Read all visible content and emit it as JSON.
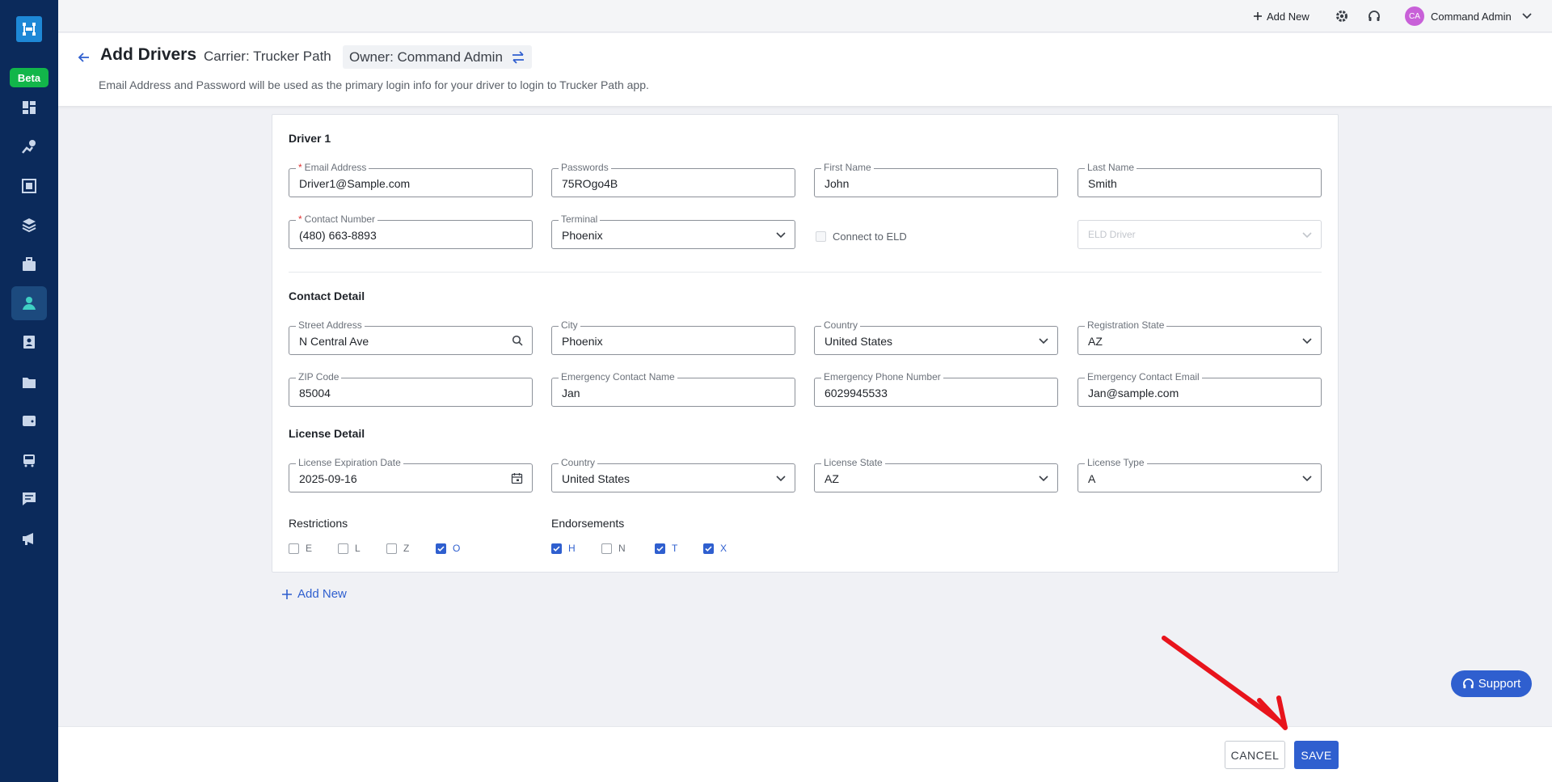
{
  "sidebar": {
    "beta_label": "Beta",
    "items": [
      {
        "icon": "dashboard-icon"
      },
      {
        "icon": "route-pin-icon"
      },
      {
        "icon": "dispatch-board-icon"
      },
      {
        "icon": "layers-icon"
      },
      {
        "icon": "briefcase-icon"
      },
      {
        "icon": "drivers-icon",
        "active": true
      },
      {
        "icon": "contact-card-icon"
      },
      {
        "icon": "folder-icon"
      },
      {
        "icon": "wallet-icon"
      },
      {
        "icon": "truck-icon"
      },
      {
        "icon": "message-icon"
      },
      {
        "icon": "megaphone-icon"
      }
    ]
  },
  "topbar": {
    "add_new_label": "Add New",
    "avatar_initials": "CA",
    "user_name": "Command Admin"
  },
  "header": {
    "title": "Add Drivers",
    "carrier": "Carrier: Trucker Path",
    "owner": "Owner: Command Admin",
    "subtitle": "Email Address and Password will be used as the primary login info for your driver to login to Trucker Path app."
  },
  "driver": {
    "section_title": "Driver 1",
    "email": {
      "label": "Email Address",
      "value": "Driver1@Sample.com"
    },
    "password": {
      "label": "Passwords",
      "value": "75ROgo4B"
    },
    "first_name": {
      "label": "First Name",
      "value": "John"
    },
    "last_name": {
      "label": "Last Name",
      "value": "Smith"
    },
    "contact_number": {
      "label": "Contact Number",
      "value": "(480) 663-8893"
    },
    "terminal": {
      "label": "Terminal",
      "value": "Phoenix"
    },
    "connect_eld_label": "Connect to ELD",
    "eld_driver_placeholder": "ELD Driver"
  },
  "contact": {
    "section_title": "Contact Detail",
    "street": {
      "label": "Street Address",
      "value": "N Central Ave"
    },
    "city": {
      "label": "City",
      "value": "Phoenix"
    },
    "country": {
      "label": "Country",
      "value": "United States"
    },
    "registration_state": {
      "label": "Registration State",
      "value": "AZ"
    },
    "zip": {
      "label": "ZIP Code",
      "value": "85004"
    },
    "emergency_name": {
      "label": "Emergency Contact Name",
      "value": "Jan"
    },
    "emergency_phone": {
      "label": "Emergency Phone Number",
      "value": "6029945533"
    },
    "emergency_email": {
      "label": "Emergency Contact Email",
      "value": "Jan@sample.com"
    }
  },
  "license": {
    "section_title": "License Detail",
    "expiration": {
      "label": "License Expiration Date",
      "value": "2025-09-16"
    },
    "country": {
      "label": "Country",
      "value": "United States"
    },
    "state": {
      "label": "License State",
      "value": "AZ"
    },
    "type": {
      "label": "License Type",
      "value": "A"
    },
    "restrictions_label": "Restrictions",
    "restrictions": [
      {
        "label": "E",
        "checked": false
      },
      {
        "label": "L",
        "checked": false
      },
      {
        "label": "Z",
        "checked": false
      },
      {
        "label": "O",
        "checked": true
      }
    ],
    "endorsements_label": "Endorsements",
    "endorsements": [
      {
        "label": "H",
        "checked": true
      },
      {
        "label": "N",
        "checked": false
      },
      {
        "label": "T",
        "checked": true
      },
      {
        "label": "X",
        "checked": true
      }
    ]
  },
  "add_new_driver_label": "Add New",
  "actions": {
    "cancel_label": "CANCEL",
    "save_label": "SAVE"
  },
  "support_label": "Support",
  "colors": {
    "primary": "#2f5fcf",
    "sidebar": "#0b2a5b",
    "annotation_arrow": "#e8141c"
  }
}
